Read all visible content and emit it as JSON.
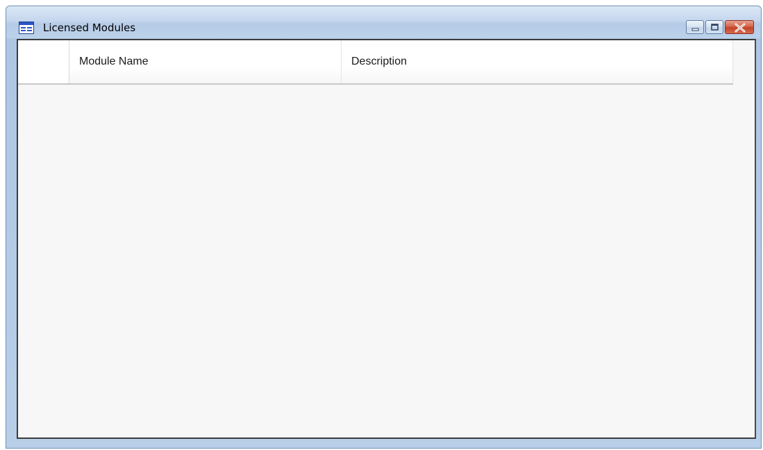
{
  "window": {
    "title": "Licensed Modules",
    "icon": "form-window-icon",
    "buttons": {
      "minimize": "minimize-icon",
      "maximize": "maximize-icon",
      "close": "close-icon"
    }
  },
  "grid": {
    "columns": [
      "Module Name",
      "Description"
    ],
    "rows": []
  },
  "colors": {
    "close_button": "#c34328",
    "titlebar": "#c5d7ee",
    "client_background": "#f7f7f7"
  }
}
